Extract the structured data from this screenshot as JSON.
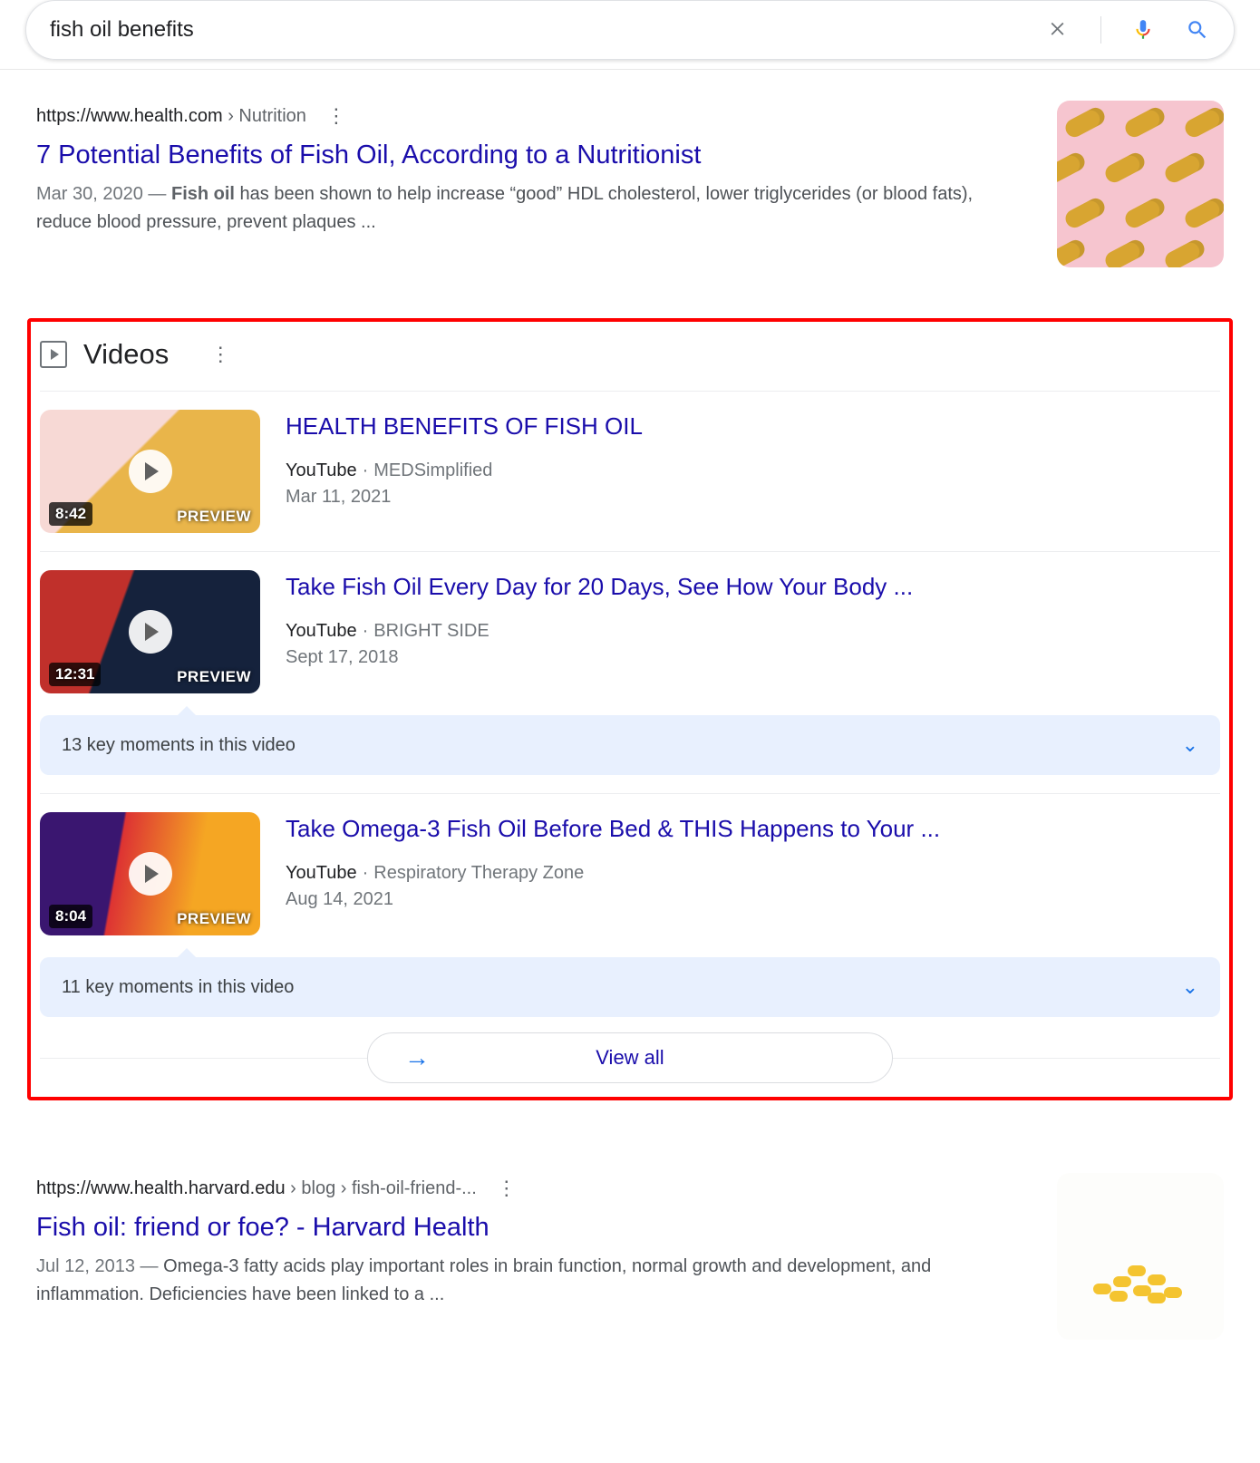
{
  "search": {
    "query": "fish oil benefits"
  },
  "results": [
    {
      "domain": "https://www.health.com",
      "path": " › Nutrition",
      "title": "7 Potential Benefits of Fish Oil, According to a Nutritionist",
      "date": "Mar 30, 2020",
      "bold": "Fish oil",
      "snippet_rest": " has been shown to help increase “good” HDL cholesterol, lower triglycerides (or blood fats), reduce blood pressure, prevent plaques ..."
    },
    {
      "domain": "https://www.health.harvard.edu",
      "path": " › blog › fish-oil-friend-...",
      "title": "Fish oil: friend or foe? - Harvard Health",
      "date": "Jul 12, 2013",
      "snippet_rest": "Omega-3 fatty acids play important roles in brain function, normal growth and development, and inflammation. Deficiencies have been linked to a ..."
    }
  ],
  "videos": {
    "heading": "Videos",
    "view_all_label": "View all",
    "preview_label": "PREVIEW",
    "items": [
      {
        "title": "HEALTH BENEFITS OF FISH OIL",
        "source": "YouTube",
        "channel": "MEDSimplified",
        "date": "Mar 11, 2021",
        "duration": "8:42"
      },
      {
        "title": "Take Fish Oil Every Day for 20 Days, See How Your Body ...",
        "source": "YouTube",
        "channel": "BRIGHT SIDE",
        "date": "Sept 17, 2018",
        "duration": "12:31",
        "key_moments": "13 key moments in this video"
      },
      {
        "title": "Take Omega-3 Fish Oil Before Bed & THIS Happens to Your ...",
        "source": "YouTube",
        "channel": "Respiratory Therapy Zone",
        "date": "Aug 14, 2021",
        "duration": "8:04",
        "key_moments": "11 key moments in this video"
      }
    ]
  }
}
